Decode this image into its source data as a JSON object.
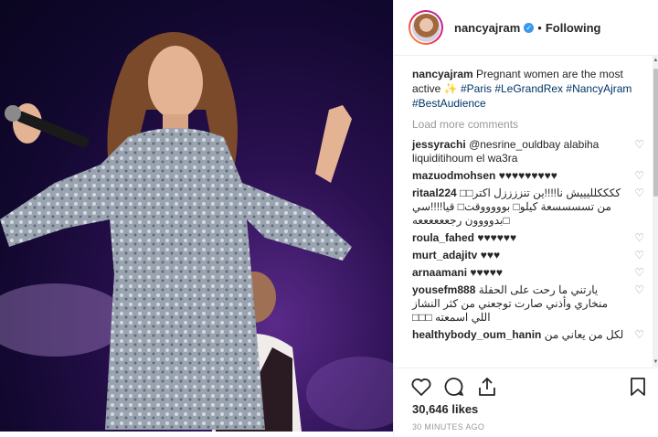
{
  "post": {
    "username": "nancyajram",
    "verified_icon": "verified-badge-icon",
    "follow_status": "Following",
    "caption": {
      "username": "nancyajram",
      "text": "Pregnant women are the most active ✨",
      "tags": [
        "#Paris",
        "#LeGrandRex",
        "#NancyAjram",
        "#BestAudience"
      ]
    },
    "load_more": "Load more comments",
    "comments": [
      {
        "user": "jessyrachi",
        "text": "@nesrine_ouldbay alabiha liquiditihoum el wa3ra"
      },
      {
        "user": "mazuodmohsen",
        "text": "♥♥♥♥♥♥♥♥♥"
      },
      {
        "user": "ritaal224",
        "text": "ككككلليييش نا!!!!ين تنززززل اكتر□□ من تسسسسعة كيلو□ بوووووقت□ قيا!!!!سي □بدوووون رجععععععه"
      },
      {
        "user": "roula_fahed",
        "text": "♥♥♥♥♥♥"
      },
      {
        "user": "murt_adajitv",
        "text": "♥♥♥"
      },
      {
        "user": "arnaamani",
        "text": "♥♥♥♥♥"
      },
      {
        "user": "yousefm888",
        "text": "يارتني ما رحت على الحفلة منخاري وأذني صارت توجعني من كثر النشاز اللي اسمعته □□□"
      },
      {
        "user": "healthybody_oum_hanin",
        "text": "لكل من يعاني من"
      }
    ],
    "likes": "30,646 likes",
    "time": "30 MINUTES AGO"
  },
  "colors": {
    "accent": "#3897f0",
    "text": "#262626",
    "muted": "#999999",
    "hashtag": "#003569"
  }
}
